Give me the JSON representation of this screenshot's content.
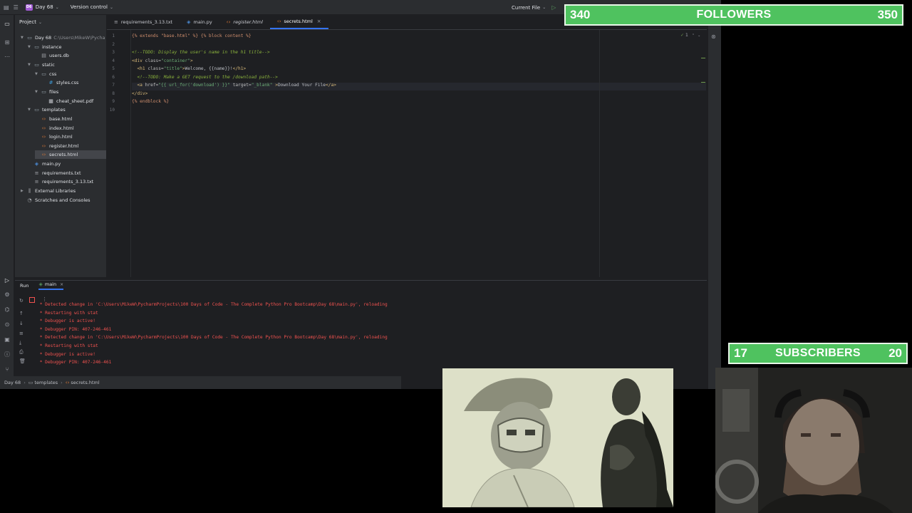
{
  "ide": {
    "project_badge": "D6",
    "project_name": "Day 68",
    "vcs": "Version control",
    "run_config": "Current File",
    "project_panel_title": "Project",
    "tree": [
      {
        "label": "Day 68",
        "extra": "C:\\Users\\MikeW\\Pycha",
        "icon": "folder",
        "depth": 0,
        "expanded": true
      },
      {
        "label": "instance",
        "icon": "folder",
        "depth": 1,
        "expanded": true
      },
      {
        "label": "users.db",
        "icon": "db",
        "depth": 2
      },
      {
        "label": "static",
        "icon": "folder",
        "depth": 1,
        "expanded": true
      },
      {
        "label": "css",
        "icon": "folder",
        "depth": 2,
        "expanded": true
      },
      {
        "label": "styles.css",
        "icon": "css",
        "depth": 3
      },
      {
        "label": "files",
        "icon": "folder",
        "depth": 2,
        "expanded": true
      },
      {
        "label": "cheat_sheet.pdf",
        "icon": "pdf",
        "depth": 3
      },
      {
        "label": "templates",
        "icon": "folder",
        "depth": 1,
        "expanded": true
      },
      {
        "label": "base.html",
        "icon": "html",
        "depth": 2
      },
      {
        "label": "index.html",
        "icon": "html",
        "depth": 2
      },
      {
        "label": "login.html",
        "icon": "html",
        "depth": 2
      },
      {
        "label": "register.html",
        "icon": "html",
        "depth": 2
      },
      {
        "label": "secrets.html",
        "icon": "html",
        "depth": 2,
        "selected": true
      },
      {
        "label": "main.py",
        "icon": "py",
        "depth": 1
      },
      {
        "label": "requirements.txt",
        "icon": "txt",
        "depth": 1
      },
      {
        "label": "requirements_3.13.txt",
        "icon": "txt",
        "depth": 1
      },
      {
        "label": "External Libraries",
        "icon": "lib",
        "depth": 0,
        "collapsed": true
      },
      {
        "label": "Scratches and Consoles",
        "icon": "scratch",
        "depth": 0
      }
    ],
    "tabs": [
      {
        "label": "requirements_3.13.txt",
        "icon": "txt"
      },
      {
        "label": "main.py",
        "icon": "py"
      },
      {
        "label": "register.html",
        "icon": "html",
        "italic": true
      },
      {
        "label": "secrets.html",
        "icon": "html",
        "active": true
      }
    ],
    "line_numbers": [
      "1",
      "2",
      "3",
      "4",
      "5",
      "6",
      "7",
      "8",
      "9",
      "10"
    ],
    "code_lines": [
      [
        {
          "t": "{% extends \"base.html\" %} {% block content %}",
          "c": "tpl"
        }
      ],
      [
        {
          "t": "",
          "c": ""
        }
      ],
      [
        {
          "t": "<!--TODO: Display the user's name in the h1 title-->",
          "c": "todo"
        }
      ],
      [
        {
          "t": "<div ",
          "c": "tag"
        },
        {
          "t": "class=",
          "c": "attr"
        },
        {
          "t": "\"container\"",
          "c": "str"
        },
        {
          "t": ">",
          "c": "tag"
        }
      ],
      [
        {
          "t": "  <h1 ",
          "c": "tag"
        },
        {
          "t": "class=",
          "c": "attr"
        },
        {
          "t": "\"title\"",
          "c": "str"
        },
        {
          "t": ">",
          "c": "tag"
        },
        {
          "t": "Welcome, {{name}}!",
          "c": ""
        },
        {
          "t": "</h1>",
          "c": "tag"
        }
      ],
      [
        {
          "t": "  <!--TODO: Make a GET request to the /download path-->",
          "c": "todo"
        }
      ],
      [
        {
          "t": "  <a ",
          "c": "tag"
        },
        {
          "t": "href=",
          "c": "attr"
        },
        {
          "t": "\"{{ url_for('download') }}\"",
          "c": "str"
        },
        {
          "t": " target=",
          "c": "attr"
        },
        {
          "t": "\"_blank\"",
          "c": "str"
        },
        {
          "t": " >",
          "c": "tag"
        },
        {
          "t": "Download Your File",
          "c": ""
        },
        {
          "t": "</a>",
          "c": "tag"
        }
      ],
      [
        {
          "t": "</div>",
          "c": "tag"
        }
      ],
      [
        {
          "t": "{% endblock %}",
          "c": "tpl"
        }
      ],
      [
        {
          "t": "",
          "c": ""
        }
      ]
    ],
    "current_line": 7,
    "inspection_count": "1",
    "run": {
      "title": "Run",
      "config": "main",
      "output": [
        " * Detected change in 'C:\\Users\\MikeW\\PycharmProjects\\100 Days of Code - The Complete Python Pro Bootcamp\\Day 68\\main.py', reloading",
        " * Restarting with stat",
        " * Debugger is active!",
        " * Debugger PIN: 407-246-461",
        " * Detected change in 'C:\\Users\\MikeW\\PycharmProjects\\100 Days of Code - The Complete Python Pro Bootcamp\\Day 68\\main.py', reloading",
        " * Restarting with stat",
        " * Debugger is active!",
        " * Debugger PIN: 407-246-461"
      ]
    },
    "breadcrumb": [
      "Day 68",
      "templates",
      "secrets.html"
    ]
  },
  "overlay": {
    "followers": {
      "current": "340",
      "label": "FOLLOWERS",
      "goal": "350"
    },
    "subscribers": {
      "current": "17",
      "label": "SUBSCRIBERS",
      "goal": "20"
    }
  },
  "colors": {
    "accent": "#3574f0",
    "counter_green": "#4fc25f",
    "error_text": "#f0524f"
  }
}
